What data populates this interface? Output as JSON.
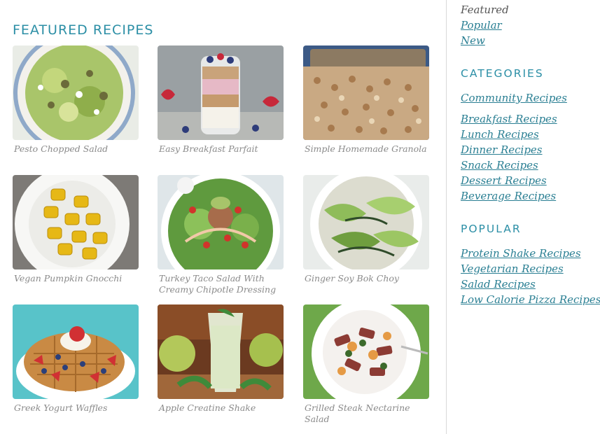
{
  "main": {
    "title": "FEATURED RECIPES",
    "recipes": [
      {
        "caption": "Pesto Chopped Salad"
      },
      {
        "caption": "Easy Breakfast Parfait"
      },
      {
        "caption": "Simple Homemade Granola"
      },
      {
        "caption": "Vegan Pumpkin Gnocchi"
      },
      {
        "caption": "Turkey Taco Salad With Creamy Chipotle Dressing"
      },
      {
        "caption": "Ginger Soy Bok Choy"
      },
      {
        "caption": "Greek Yogurt Waffles"
      },
      {
        "caption": "Apple Creatine Shake"
      },
      {
        "caption": "Grilled Steak Nectarine Salad"
      }
    ]
  },
  "sidebar": {
    "tabs": {
      "featured": "Featured",
      "popular": "Popular",
      "new": "New"
    },
    "categories_heading": "CATEGORIES",
    "community": "Community Recipes",
    "categories": [
      "Breakfast Recipes",
      "Lunch Recipes",
      "Dinner Recipes",
      "Snack Recipes",
      "Dessert Recipes",
      "Beverage Recipes"
    ],
    "popular_heading": "POPULAR",
    "popular": [
      "Protein Shake Recipes",
      "Vegetarian Recipes",
      "Salad Recipes",
      "Low Calorie Pizza Recipes"
    ]
  },
  "colors": {
    "accent": "#2c8fa6",
    "link": "#2a7f93",
    "caption": "#8a8a8a"
  }
}
